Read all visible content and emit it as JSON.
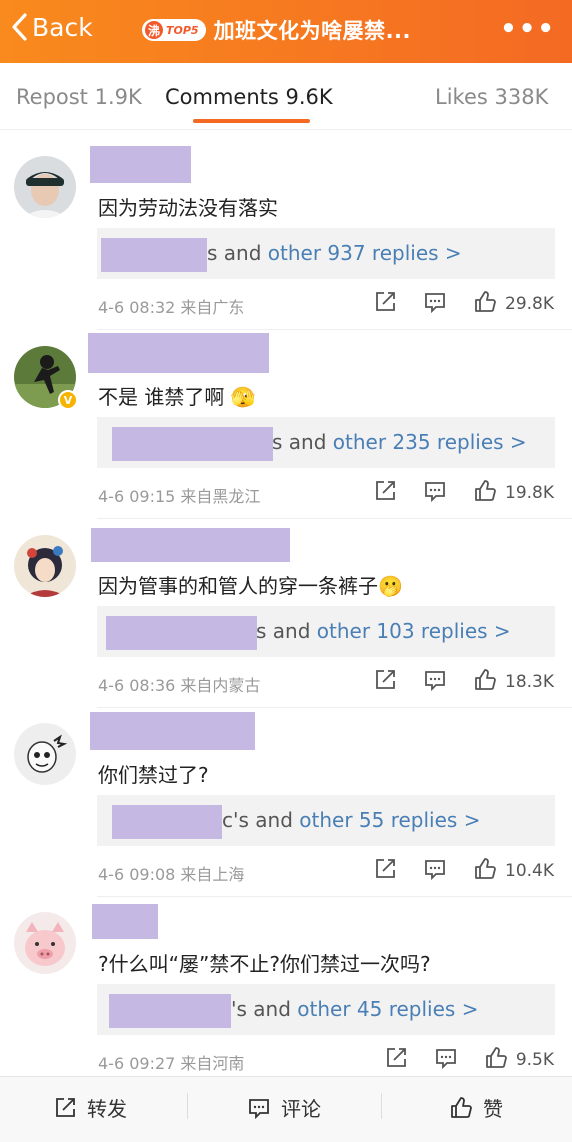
{
  "header": {
    "back_label": "Back",
    "badge_char": "沸",
    "badge_rank": "TOP5",
    "title": "加班文化为啥屡禁...",
    "more_label": "•••",
    "bg_color": "#f46a23"
  },
  "tabs": [
    {
      "label": "Repost 1.9K",
      "active": false
    },
    {
      "label": "Comments 9.6K",
      "active": true
    },
    {
      "label": "Likes 338K",
      "active": false
    }
  ],
  "comments": [
    {
      "text": "因为劳动法没有落实",
      "replies_suffix": "s and ",
      "replies_link": "other 937 replies >",
      "meta": "4-6 08:32 来自广东",
      "likes": "29.8K",
      "verified": false,
      "avatar_icon": "avatar-photo-girl-cap"
    },
    {
      "text": "不是 谁禁了啊",
      "emoji": "🫣",
      "replies_suffix": "s and ",
      "replies_link": "other 235 replies >",
      "meta": "4-6 09:15 来自黑龙江",
      "likes": "19.8K",
      "verified": true,
      "verified_mark": "V",
      "avatar_icon": "avatar-photo-martial-arts"
    },
    {
      "text": "因为管事的和管人的穿一条裤子",
      "emoji": "🫢",
      "replies_suffix": "s and ",
      "replies_link": "other 103 replies >",
      "meta": "4-6 08:36 来自内蒙古",
      "likes": "18.3K",
      "verified": false,
      "avatar_icon": "avatar-illustration-girl"
    },
    {
      "text": "你们禁过了?",
      "replies_suffix": "c's and ",
      "replies_link": "other 55 replies >",
      "meta": "4-6 09:08 来自上海",
      "likes": "10.4K",
      "verified": false,
      "avatar_icon": "avatar-cartoon-skull"
    },
    {
      "text": "?什么叫“屡”禁不止?你们禁过一次吗?",
      "replies_suffix": "'s and ",
      "replies_link": "other 45 replies >",
      "meta": "4-6 09:27 来自河南",
      "likes": "9.5K",
      "verified": false,
      "avatar_icon": "avatar-pig-face"
    }
  ],
  "bottom_bar": {
    "repost_label": "转发",
    "comment_label": "评论",
    "like_label": "赞"
  }
}
